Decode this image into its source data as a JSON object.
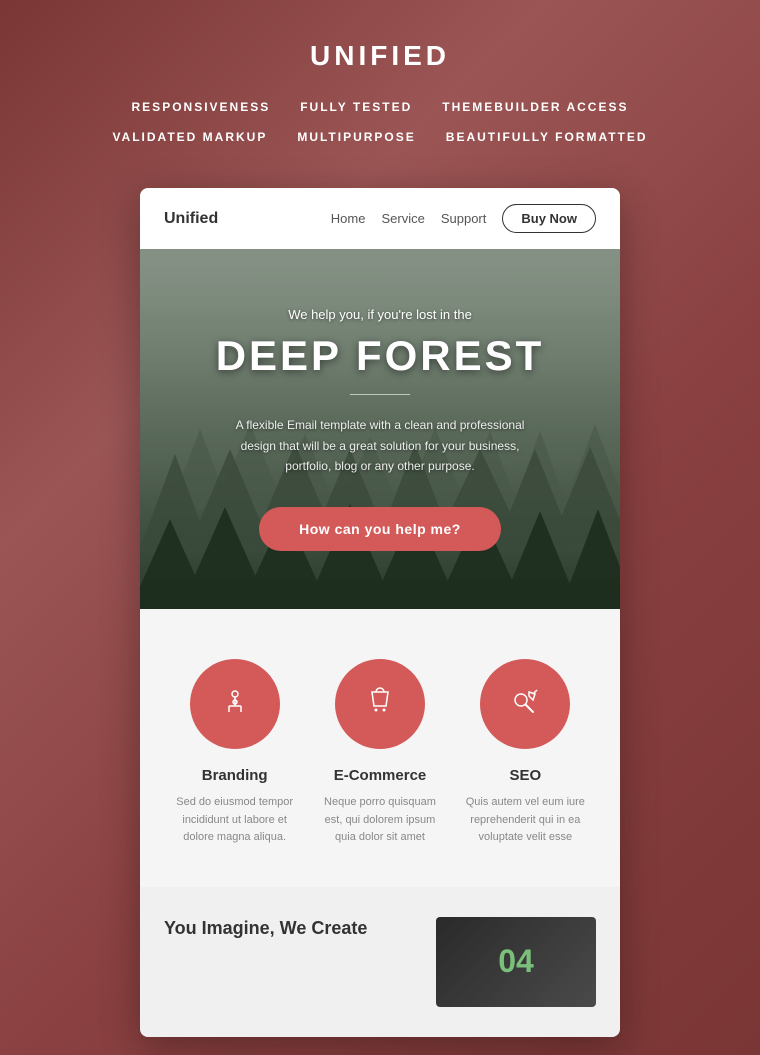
{
  "background": {
    "color": "#8B4A4A"
  },
  "header": {
    "title": "UNIFIED",
    "features": [
      {
        "label": "RESPONSIVENESS"
      },
      {
        "label": "FULLY TESTED"
      },
      {
        "label": "THEMEBUILDER ACCESS"
      },
      {
        "label": "VALIDATED MARKUP"
      },
      {
        "label": "MULTIPURPOSE"
      },
      {
        "label": "BEAUTIFULLY FORMATTED"
      }
    ]
  },
  "card": {
    "nav": {
      "logo": "Unified",
      "links": [
        {
          "label": "Home"
        },
        {
          "label": "Service"
        },
        {
          "label": "Support"
        }
      ],
      "cta_label": "Buy Now"
    },
    "hero": {
      "subtitle": "We help you, if you're lost in the",
      "title": "DEEP FOREST",
      "description": "A flexible Email template with a clean and professional design that will be a great solution for your business, portfolio, blog or any other purpose.",
      "cta_label": "How can you help me?"
    },
    "services": [
      {
        "icon": "⚗",
        "title": "Branding",
        "description": "Sed do eiusmod tempor incididunt ut labore et dolore magna aliqua."
      },
      {
        "icon": "🛍",
        "title": "E-Commerce",
        "description": "Neque porro quisquam est, qui dolorem ipsum quia dolor sit amet"
      },
      {
        "icon": "🚀",
        "title": "SEO",
        "description": "Quis autem vel eum iure reprehenderit qui in ea voluptate velit esse"
      }
    ],
    "bottom": {
      "title": "You Imagine, We Create",
      "image_number": "04"
    }
  }
}
